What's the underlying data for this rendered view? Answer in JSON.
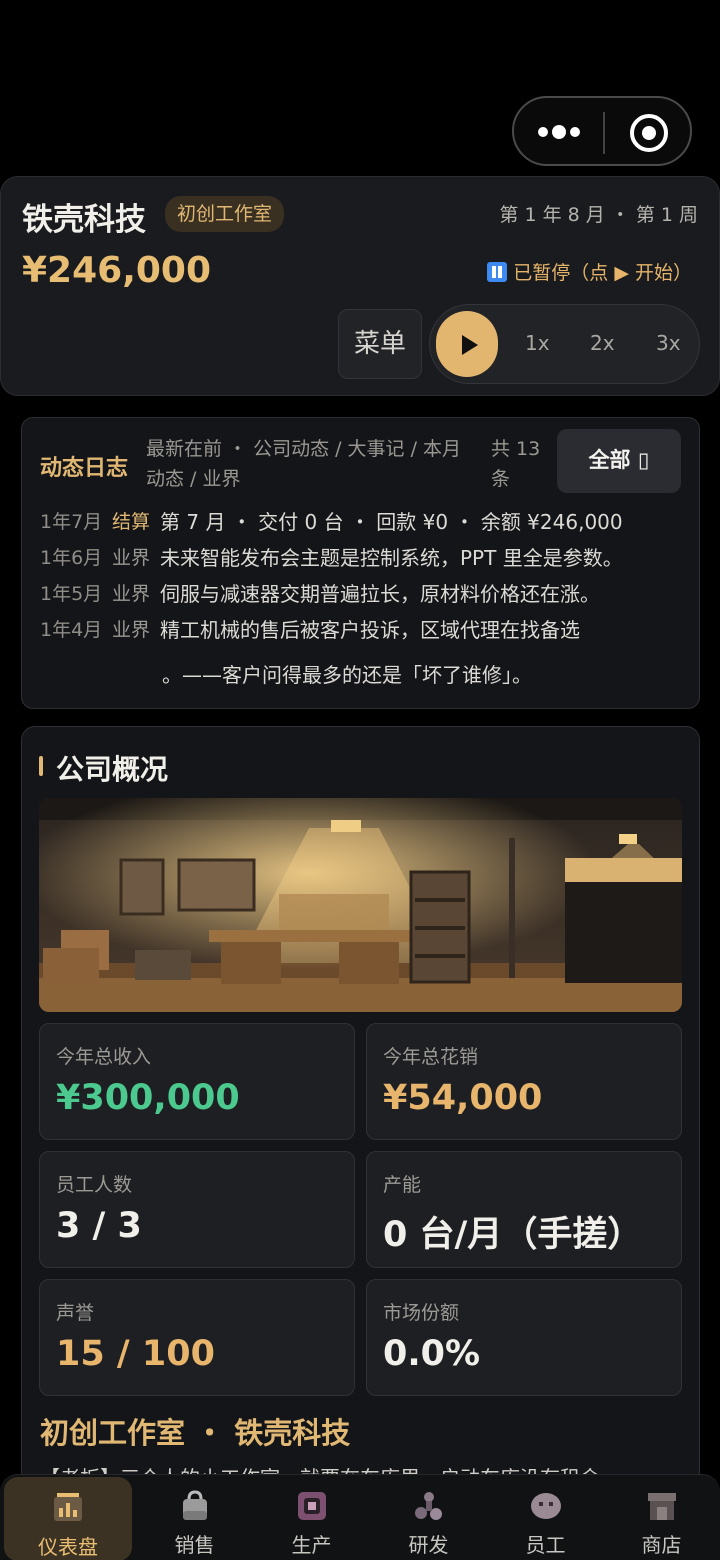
{
  "header": {
    "company_name": "铁壳科技",
    "stage_badge": "初创工作室",
    "date": "第 1 年 8 月 ・ 第 1 周",
    "money": "¥246,000",
    "pause_status": "已暂停（点 ▶ 开始）",
    "menu_label": "菜单",
    "speeds": [
      "1x",
      "2x",
      "3x"
    ]
  },
  "log": {
    "title": "动态日志",
    "filter": "最新在前 ・ 公司动态 / 大事记 / 本月动态 / 业界",
    "count": "共 13 条",
    "all_button": "全部 ▯",
    "entries": [
      {
        "date": "1年7月",
        "tag": "结算",
        "text": "第 7 月 ・ 交付 0 台 ・ 回款 ¥0 ・ 余额 ¥246,000"
      },
      {
        "date": "1年6月",
        "tag": "业界",
        "text": "未来智能发布会主题是控制系统，PPT 里全是参数。"
      },
      {
        "date": "1年5月",
        "tag": "业界",
        "text": "伺服与减速器交期普遍拉长，原材料价格还在涨。"
      },
      {
        "date": "1年4月",
        "tag": "业界",
        "text": "精工机械的售后被客户投诉，区域代理在找备选"
      }
    ],
    "continuation": "。——客户问得最多的还是「坏了谁修」。"
  },
  "overview": {
    "title": "公司概况",
    "stats": [
      {
        "label": "今年总收入",
        "value": "¥300,000",
        "color": "#4cc98e"
      },
      {
        "label": "今年总花销",
        "value": "¥54,000",
        "color": "#e7b56b"
      },
      {
        "label": "员工人数",
        "value": "3 / 3",
        "color": "#f1efe9"
      },
      {
        "label": "产能",
        "value": "0 台/月（手搓）",
        "color": "#f1efe9"
      },
      {
        "label": "声誉",
        "value": "15 / 100",
        "color": "#e7b56b"
      },
      {
        "label": "市场份额",
        "value": "0.0%",
        "color": "#f1efe9"
      }
    ],
    "sub_title": "初创工作室 ・ 铁壳科技",
    "sub_desc": "【老板】三个人的小工作室，就要在车库里，启动车库没有租金"
  },
  "tabs": [
    {
      "label": "仪表盘",
      "icon": "dashboard-icon"
    },
    {
      "label": "销售",
      "icon": "sales-bag-icon"
    },
    {
      "label": "生产",
      "icon": "production-icon"
    },
    {
      "label": "研发",
      "icon": "research-icon"
    },
    {
      "label": "员工",
      "icon": "staff-icon"
    },
    {
      "label": "商店",
      "icon": "shop-icon"
    }
  ]
}
